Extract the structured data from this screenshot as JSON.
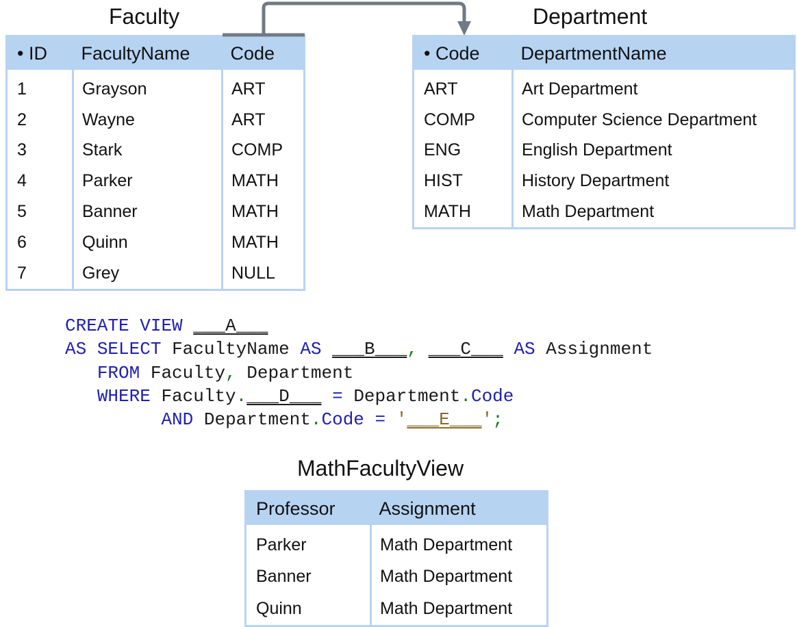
{
  "faculty": {
    "title": "Faculty",
    "columns": [
      "• ID",
      "FacultyName",
      "Code"
    ],
    "rows": [
      [
        "1",
        "Grayson",
        "ART"
      ],
      [
        "2",
        "Wayne",
        "ART"
      ],
      [
        "3",
        "Stark",
        "COMP"
      ],
      [
        "4",
        "Parker",
        "MATH"
      ],
      [
        "5",
        "Banner",
        "MATH"
      ],
      [
        "6",
        "Quinn",
        "MATH"
      ],
      [
        "7",
        "Grey",
        "NULL"
      ]
    ]
  },
  "department": {
    "title": "Department",
    "columns": [
      "• Code",
      "DepartmentName"
    ],
    "rows": [
      [
        "ART",
        "Art Department"
      ],
      [
        "COMP",
        "Computer Science Department"
      ],
      [
        "ENG",
        "English Department"
      ],
      [
        "HIST",
        "History Department"
      ],
      [
        "MATH",
        "Math Department"
      ]
    ]
  },
  "sql": {
    "line1": {
      "kw_create": "CREATE",
      "kw_view": "VIEW",
      "blank_a": "A"
    },
    "line2": {
      "kw_as": "AS",
      "kw_select": "SELECT",
      "col": "FacultyName",
      "kw_as2": "AS",
      "blank_b": "B",
      "comma": ",",
      "blank_c": "C",
      "kw_as3": "AS",
      "alias": "Assignment"
    },
    "line3": {
      "kw_from": "FROM",
      "table1": "Faculty",
      "comma": ",",
      "table2": "Department"
    },
    "line4": {
      "kw_where": "WHERE",
      "table": "Faculty",
      "dot": ".",
      "blank_d": "D",
      "eq": "=",
      "table2": "Department",
      "dot2": ".",
      "col": "Code"
    },
    "line5": {
      "kw_and": "AND",
      "table": "Department",
      "dot": ".",
      "col": "Code",
      "eq": "=",
      "quote_open": "'",
      "blank_e": "E",
      "quote_close": "'",
      "semicolon": ";"
    }
  },
  "view": {
    "title": "MathFacultyView",
    "columns": [
      "Professor",
      "Assignment"
    ],
    "rows": [
      [
        "Parker",
        "Math Department"
      ],
      [
        "Banner",
        "Math Department"
      ],
      [
        "Quinn",
        "Math Department"
      ]
    ]
  },
  "colors": {
    "header_bg": "#b7d3f2",
    "arrow": "#707a85",
    "keyword": "#1f1fb4",
    "punct": "#1b7a1b",
    "string": "#8a6a2a"
  }
}
